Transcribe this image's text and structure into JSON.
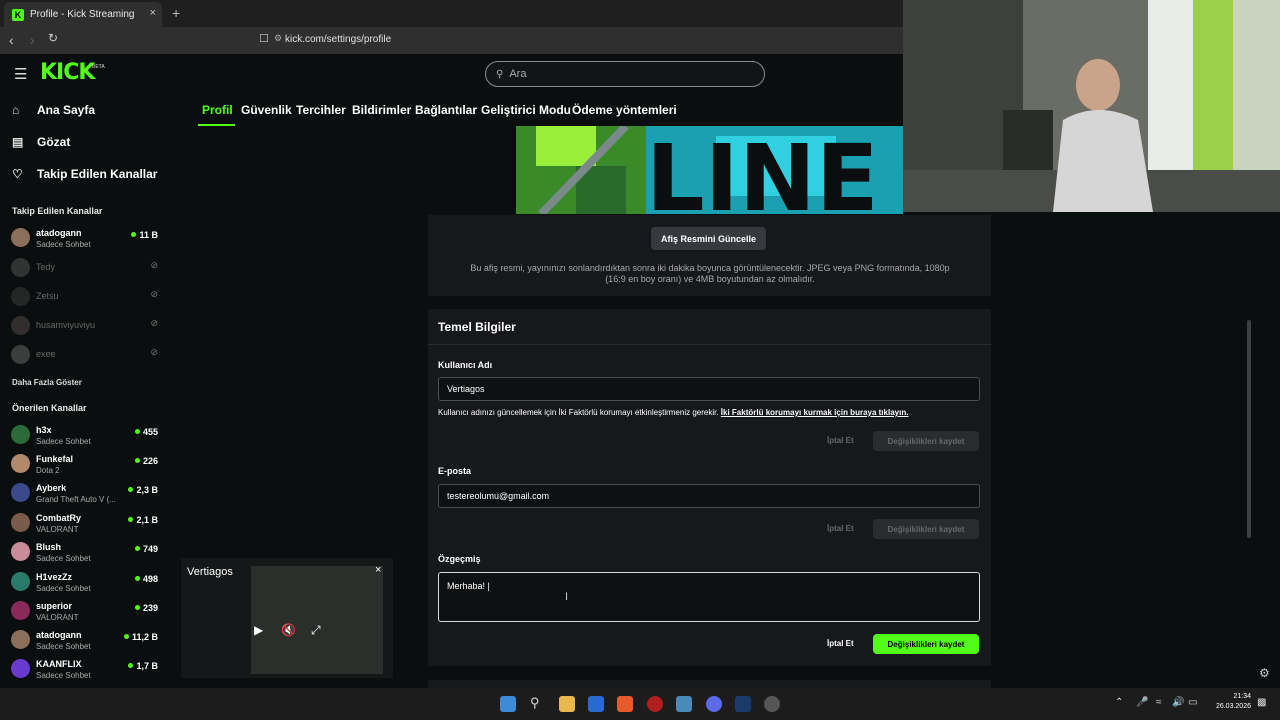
{
  "browser": {
    "tab_title": "Profile - Kick Streaming",
    "tab_favicon": "K",
    "tab_close": "×",
    "new_tab": "+",
    "url": "kick.com/settings/profile"
  },
  "app": {
    "logo": "KICK",
    "beta": "BETA",
    "search_placeholder": "Ara",
    "accent_color": "#53fc18"
  },
  "sidebar": {
    "nav": [
      {
        "label": "Ana Sayfa",
        "icon": "home-icon"
      },
      {
        "label": "Gözat",
        "icon": "browse-icon"
      },
      {
        "label": "Takip Edilen Kanallar",
        "icon": "heart-icon"
      }
    ],
    "followed_header": "Takip Edilen Kanallar",
    "followed": [
      {
        "name": "atadogann",
        "category": "Sadece Sohbet",
        "viewers": "11 B",
        "online": true
      },
      {
        "name": "Tedy",
        "online": false
      },
      {
        "name": "Zetsu",
        "online": false
      },
      {
        "name": "husamviyuviyu",
        "online": false
      },
      {
        "name": "exee",
        "online": false
      }
    ],
    "show_more": "Daha Fazla Göster",
    "recommended_header": "Önerilen Kanallar",
    "recommended": [
      {
        "name": "h3x",
        "category": "Sadece Sohbet",
        "viewers": "455"
      },
      {
        "name": "Funkefal",
        "category": "Dota 2",
        "viewers": "226"
      },
      {
        "name": "Ayberk",
        "category": "Grand Theft Auto V (...",
        "viewers": "2,3 B"
      },
      {
        "name": "CombatRy",
        "category": "VALORANT",
        "viewers": "2,1 B"
      },
      {
        "name": "Blush",
        "category": "Sadece Sohbet",
        "viewers": "749"
      },
      {
        "name": "H1vezZz",
        "category": "Sadece Sohbet",
        "viewers": "498"
      },
      {
        "name": "superior",
        "category": "VALORANT",
        "viewers": "239"
      },
      {
        "name": "atadogann",
        "category": "Sadece Sohbet",
        "viewers": "11,2 B"
      },
      {
        "name": "KAANFLIX",
        "category": "Sadece Sohbet",
        "viewers": "1,7 B"
      }
    ]
  },
  "settings_tabs": [
    "Profil",
    "Güvenlik",
    "Tercihler",
    "Bildirimler",
    "Bağlantılar",
    "Geliştirici Modu",
    "Ödeme yöntemleri"
  ],
  "banner": {
    "text": "LINE",
    "update_button": "Afiş Resmini Güncelle",
    "description_line1": "Bu afiş resmi, yayınınızı sonlandırdıktan sonra iki dakika boyunca görüntülenecektir. JPEG veya PNG formatında, 1080p",
    "description_line2": "(16:9 en boy oranı) ve 4MB boyutundan az olmalıdır."
  },
  "basic": {
    "title": "Temel Bilgiler",
    "username_label": "Kullanıcı Adı",
    "username_value": "Vertiagos",
    "twofa_note": "Kullanıcı adınızı güncellemek için İki Faktörlü korumayı etkinleştirmeniz gerekir.",
    "twofa_link": "İki Faktörlü korumayı kurmak için buraya tıklayın.",
    "cancel": "İptal Et",
    "save": "Değişiklikleri kaydet",
    "email_label": "E-posta",
    "email_value": "testereolumu@gmail.com",
    "bio_label": "Özgeçmiş",
    "bio_value": "Merhaba! |"
  },
  "mini_player": {
    "title": "Vertiagos",
    "close": "×"
  },
  "taskbar": {
    "time": "21:34",
    "date": "26.03.2026"
  }
}
